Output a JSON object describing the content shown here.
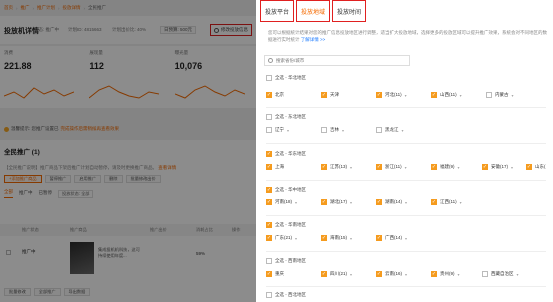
{
  "left": {
    "breadcrumb": [
      "首页",
      "推广",
      "推广计划",
      "投放详情",
      "全民推广"
    ],
    "plan_title": "投放机详情",
    "meta": [
      "状态: 推广中",
      "计划ID: 4815663",
      "计划出价比: 40%"
    ],
    "budget_label": "日预算: 500元",
    "modify_button": "修改投放信息",
    "stats": [
      {
        "label": "消费",
        "value": "221.88"
      },
      {
        "label": "展现量",
        "value": "112"
      },
      {
        "label": "曝光量",
        "value": "10,076"
      }
    ],
    "tip_text": "温馨提示: 您推广设置已",
    "tip_highlight": "完成操作后需稍候再查看效果",
    "section_title": "全民推广 (1)",
    "section_notice": "【全民推广说明】推广商品下架后推广计划自动暂停，请及时更换推广商品。",
    "section_notice_link": "查看详情",
    "buttons": [
      "+添加推广商品",
      "暂停推广",
      "启用推广",
      "删除",
      "批量修改出价"
    ],
    "tabs": [
      "全部",
      "推广中",
      "已暂停"
    ],
    "filter_select": "投放状态: 全部",
    "table_headers": [
      "推广状态",
      "推广商品",
      "推广出价",
      "消耗占比",
      "操作"
    ],
    "row": {
      "status": "推广中",
      "desc": "集成投机机科技，这可持续使用年度...",
      "pct": "59%"
    },
    "footer_buttons": [
      "批量修改",
      "全部推广",
      "导出数据"
    ]
  },
  "panel": {
    "tabs": [
      {
        "label": "投放平台",
        "active": false
      },
      {
        "label": "投放地域",
        "active": true
      },
      {
        "label": "投放时间",
        "active": false
      }
    ],
    "description": "您可以根据统计结果对您的推广信息投放地区进行调整，适当扩大投放地域，选择更多的投放区域可以提升推广效果，系统会对不同地区的数据进行实时统计",
    "description_more": "了解详情 >>",
    "search_placeholder": "搜索省份/城市",
    "regions": [
      {
        "name": "全选 - 华北地区",
        "checked": false
      },
      {
        "name": "全选 - 东北地区",
        "checked": false
      },
      {
        "name": "全选 - 华东地区",
        "checked": true
      },
      {
        "name": "全选 - 华中地区",
        "checked": true
      },
      {
        "name": "全选 - 华南地区",
        "checked": true
      },
      {
        "name": "全选 - 西南地区",
        "checked": false
      },
      {
        "name": "全选 - 西北地区",
        "checked": false
      }
    ],
    "provinces": [
      {
        "name": "北京",
        "checked": true,
        "chev": false
      },
      {
        "name": "天津",
        "checked": true,
        "chev": false
      },
      {
        "name": "河北(11)",
        "checked": true,
        "chev": true
      },
      {
        "name": "山西(11)",
        "checked": true,
        "chev": true
      },
      {
        "name": "内蒙古",
        "checked": false,
        "chev": true
      },
      {
        "name": "辽宁",
        "checked": false,
        "chev": true
      },
      {
        "name": "吉林",
        "checked": false,
        "chev": true
      },
      {
        "name": "黑龙江",
        "checked": false,
        "chev": true
      },
      {
        "name": "上海",
        "checked": true,
        "chev": false
      },
      {
        "name": "江苏(13)",
        "checked": true,
        "chev": true
      },
      {
        "name": "浙江(11)",
        "checked": true,
        "chev": true
      },
      {
        "name": "福建(9)",
        "checked": true,
        "chev": true
      },
      {
        "name": "安徽(17)",
        "checked": true,
        "chev": true
      },
      {
        "name": "山东(",
        "checked": true,
        "chev": false
      },
      {
        "name": "河南(18)",
        "checked": true,
        "chev": true
      },
      {
        "name": "湖北(17)",
        "checked": true,
        "chev": true
      },
      {
        "name": "湖南(14)",
        "checked": true,
        "chev": true
      },
      {
        "name": "江西(11)",
        "checked": true,
        "chev": true
      },
      {
        "name": "广东(21)",
        "checked": true,
        "chev": true
      },
      {
        "name": "海南(15)",
        "checked": true,
        "chev": true
      },
      {
        "name": "广西(14)",
        "checked": true,
        "chev": true
      },
      {
        "name": "重庆",
        "checked": true,
        "chev": false
      },
      {
        "name": "四川(21)",
        "checked": true,
        "chev": true
      },
      {
        "name": "云南(16)",
        "checked": true,
        "chev": true
      },
      {
        "name": "贵州(9)",
        "checked": true,
        "chev": true
      },
      {
        "name": "西藏自治区",
        "checked": false,
        "chev": true
      }
    ],
    "colors": {
      "accent": "#f56a00",
      "checkbox": "#f59b1e",
      "highlight_box": "#e02020"
    }
  }
}
